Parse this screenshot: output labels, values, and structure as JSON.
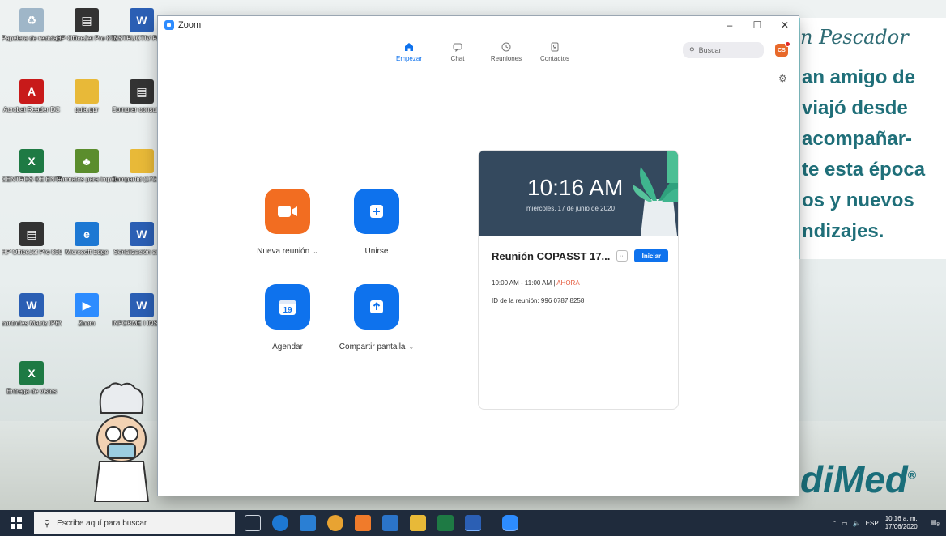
{
  "desktop": {
    "icons": [
      {
        "label": "Papelera de reciclaje",
        "glyph": "recycle"
      },
      {
        "label": "HP OfficeJet Pro 8720",
        "glyph": "printer"
      },
      {
        "label": "INSTRUCTIV PARA DILIG",
        "glyph": "W"
      },
      {
        "label": "Acrobat Reader DC",
        "glyph": "pdf"
      },
      {
        "label": "guia.ppr",
        "glyph": "folder"
      },
      {
        "label": "Comprar consumible",
        "glyph": "printer"
      },
      {
        "label": "CENTROS DE ENTRENAMIE...",
        "glyph": "X"
      },
      {
        "label": "Formatos para imprimir",
        "glyph": "tree"
      },
      {
        "label": "Compartid (172.21.15.4)",
        "glyph": "folder"
      },
      {
        "label": "HP OfficeJet Pro 8500 A910",
        "glyph": "printer"
      },
      {
        "label": "Microsoft Edge",
        "glyph": "e"
      },
      {
        "label": "Señalización sedes",
        "glyph": "W"
      },
      {
        "label": "controles Matriz IPEVAR",
        "glyph": "W"
      },
      {
        "label": "Zoom",
        "glyph": "zoom"
      },
      {
        "label": "INFORME I INSPECCION",
        "glyph": "W"
      },
      {
        "label": "Entrega de vistos",
        "glyph": "X"
      }
    ],
    "wallpaper": {
      "script": "n Pescador",
      "lines": [
        "an amigo de",
        "viajó desde",
        "acompañar-",
        "te esta época",
        "os y nuevos",
        "ndizajes."
      ],
      "brand": "diMed"
    }
  },
  "window": {
    "title": "Zoom",
    "controls": {
      "minimize": "–",
      "maximize": "☐",
      "close": "✕"
    }
  },
  "nav": {
    "tabs": [
      {
        "label": "Empezar",
        "icon": "home-icon",
        "active": true
      },
      {
        "label": "Chat",
        "icon": "chat-icon",
        "active": false
      },
      {
        "label": "Reuniones",
        "icon": "clock-icon",
        "active": false
      },
      {
        "label": "Contactos",
        "icon": "contacts-icon",
        "active": false
      }
    ],
    "search_placeholder": "Buscar",
    "avatar_initials": "CS"
  },
  "actions": {
    "new_meeting": "Nueva reunión",
    "join": "Unirse",
    "schedule": "Agendar",
    "schedule_day": "19",
    "share_screen": "Compartir pantalla"
  },
  "card": {
    "time": "10:16 AM",
    "date": "miércoles, 17 de junio de 2020",
    "meeting_title": "Reunión COPASST 17...",
    "more_label": "···",
    "start_label": "Iniciar",
    "meeting_range": "10:00 AM - 11:00 AM",
    "separator": "|",
    "now_label": "AHORA",
    "meeting_id": "ID de la reunión: 996 0787 8258"
  },
  "taskbar": {
    "search_placeholder": "Escribe aquí para buscar",
    "language": "ESP",
    "time": "10:16 a. m.",
    "date": "17/06/2020",
    "notification_count": "8"
  },
  "colors": {
    "zoom_blue": "#0e72ed",
    "zoom_orange": "#f26d21",
    "card_hero": "#34495e",
    "now_red": "#e55a3c",
    "taskbar": "#1f2b3c"
  }
}
